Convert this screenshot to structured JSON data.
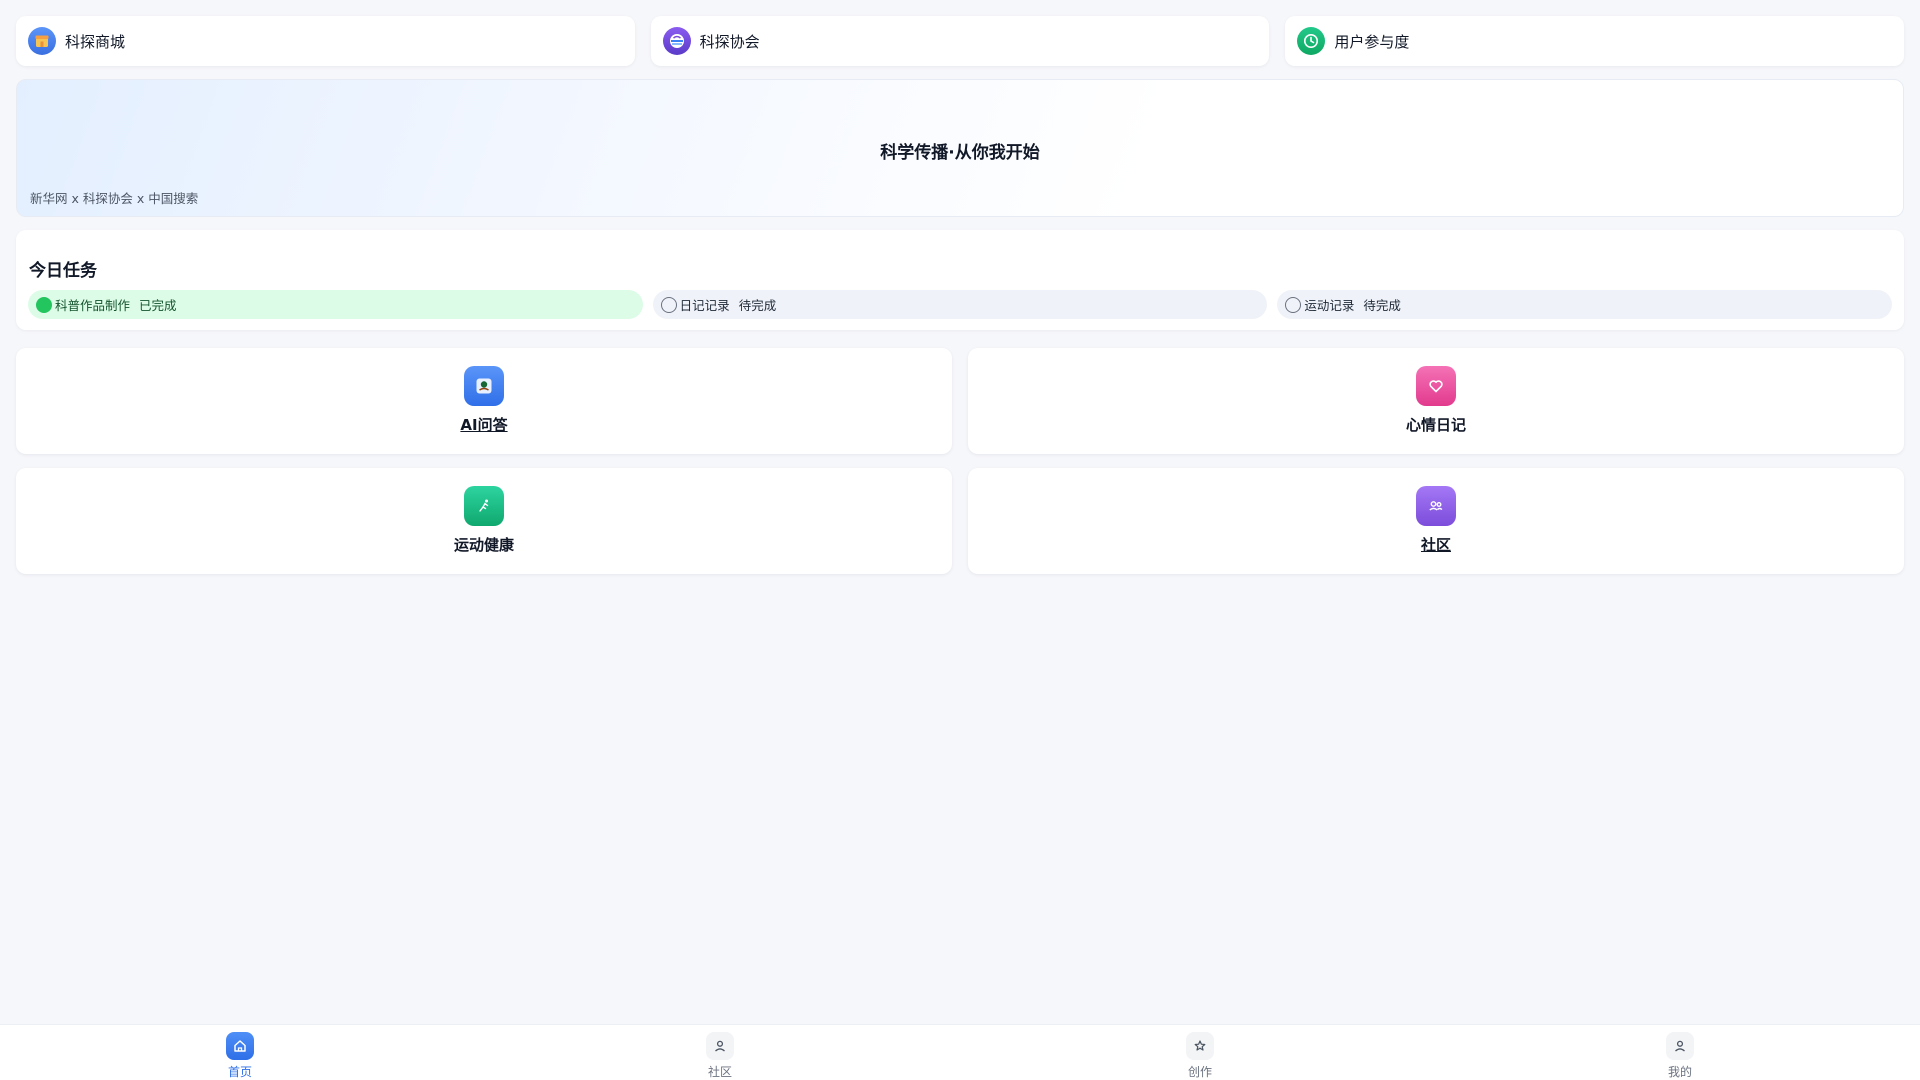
{
  "quick_links": [
    {
      "label": "科探商城",
      "icon": "shop-icon",
      "color": "#4f86f7"
    },
    {
      "label": "科探协会",
      "icon": "association-icon",
      "color": "#7c4ddb"
    },
    {
      "label": "用户参与度",
      "icon": "clock-icon",
      "color": "#18b86f"
    }
  ],
  "banner": {
    "title": "科学传播·从你我开始",
    "subtitle": "新华网 x 科探协会 x 中国搜索"
  },
  "tasks": {
    "title": "今日任务",
    "items": [
      {
        "label": "科普作品制作",
        "status": "已完成",
        "done": true
      },
      {
        "label": "日记记录",
        "status": "待完成",
        "done": false
      },
      {
        "label": "运动记录",
        "status": "待完成",
        "done": false
      }
    ]
  },
  "features": [
    {
      "label": "AI问答",
      "icon": "ai-chat-icon",
      "color": "#3f7ef0"
    },
    {
      "label": "心情日记",
      "icon": "heart-icon",
      "color": "#ec4899"
    },
    {
      "label": "运动健康",
      "icon": "running-icon",
      "color": "#10b981"
    },
    {
      "label": "社区",
      "icon": "people-icon",
      "color": "#8b5cf6"
    }
  ],
  "bottom_nav": [
    {
      "label": "首页",
      "icon": "home-icon",
      "active": true
    },
    {
      "label": "社区",
      "icon": "user-icon",
      "active": false
    },
    {
      "label": "创作",
      "icon": "star-icon",
      "active": false
    },
    {
      "label": "我的",
      "icon": "user-icon",
      "active": false
    }
  ],
  "colors": {
    "accent": "#2f6fe8",
    "success": "#22c55e",
    "background": "#f6f7fb"
  }
}
